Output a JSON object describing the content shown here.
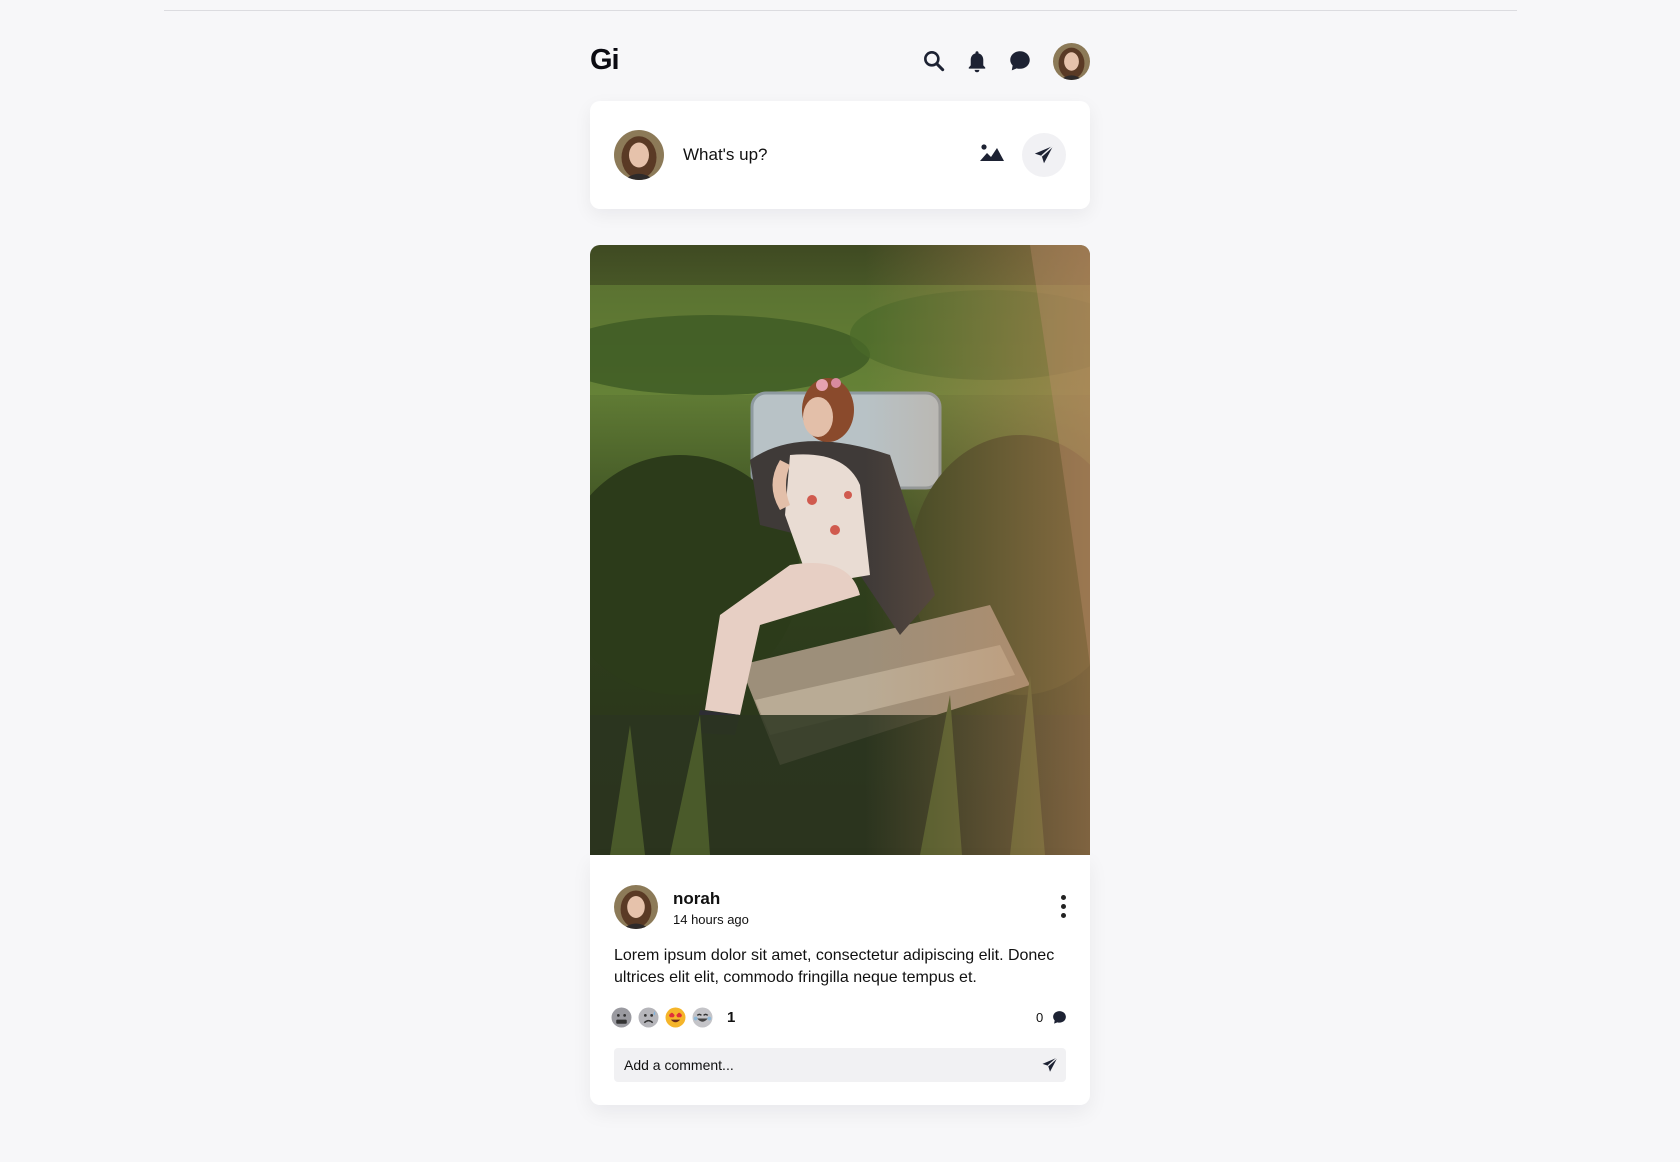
{
  "app": {
    "logo": "Gi"
  },
  "header": {
    "icons": [
      "search-icon",
      "bell-icon",
      "chat-bubble-icon"
    ],
    "avatar": "profile-avatar"
  },
  "composer": {
    "placeholder": "What's up?",
    "icons": [
      "image-icon",
      "send-icon"
    ]
  },
  "post": {
    "author": "norah",
    "time": "14 hours ago",
    "text": "Lorem ipsum dolor sit amet, consectetur adipiscing elit. Donec ultrices elit elit, commodo fringilla neque tempus et.",
    "reactions": [
      "face-with-symbols-on-mouth",
      "anxious-face-with-sweat",
      "smiling-face-with-heart-eyes",
      "face-with-tears-of-joy"
    ],
    "reaction_count": "1",
    "comment_count": "0",
    "comment_placeholder": "Add a comment..."
  },
  "colors": {
    "background": "#f7f7f9",
    "card": "#ffffff",
    "icon": "#1d2233",
    "input_bg": "#f1f1f3"
  }
}
